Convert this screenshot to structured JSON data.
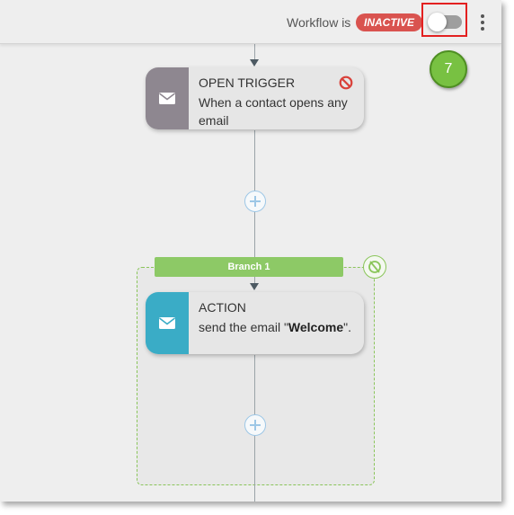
{
  "header": {
    "workflow_label": "Workflow is",
    "status": "INACTIVE",
    "status_color": "#d9534f",
    "toggle_on": false
  },
  "annotation": {
    "step_number": "7",
    "badge_color": "#78c142"
  },
  "trigger": {
    "title": "OPEN TRIGGER",
    "description": "When a contact opens any email",
    "icon": "envelope-icon",
    "status_icon": "prohibited-icon",
    "accent": "#8e8790"
  },
  "branch": {
    "label": "Branch 1",
    "accent": "#8dc966"
  },
  "action": {
    "title": "ACTION",
    "desc_prefix": "send the email \"",
    "email_name": "Welcome",
    "desc_suffix": "\".",
    "icon": "envelope-icon",
    "accent": "#3aacc6"
  }
}
